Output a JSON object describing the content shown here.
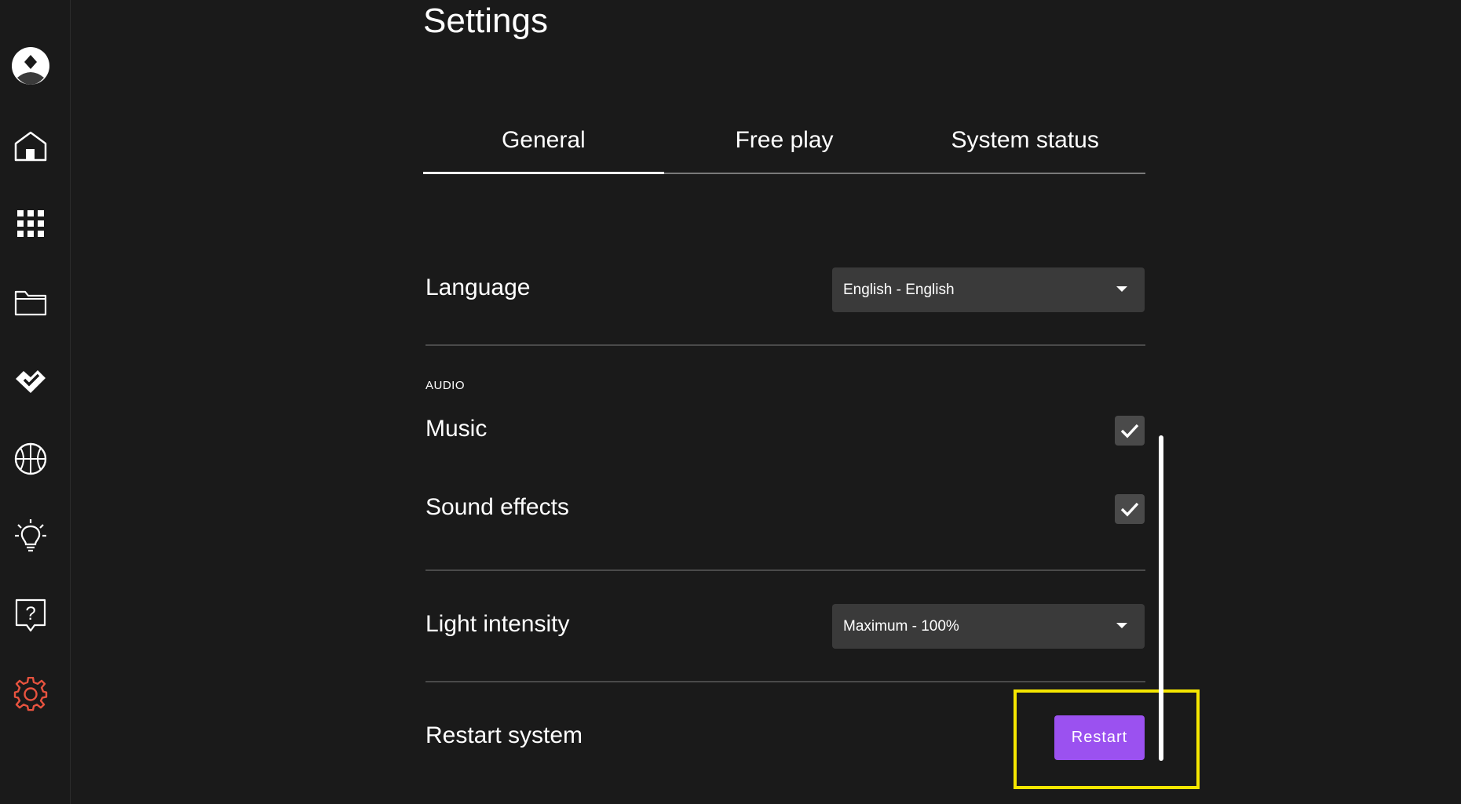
{
  "page": {
    "title": "Settings"
  },
  "sidebar": {
    "items": [
      {
        "icon": "avatar-icon"
      },
      {
        "icon": "home-icon"
      },
      {
        "icon": "grid-icon"
      },
      {
        "icon": "folder-icon"
      },
      {
        "icon": "heart-check-icon"
      },
      {
        "icon": "basketball-icon"
      },
      {
        "icon": "lightbulb-icon"
      },
      {
        "icon": "help-icon"
      },
      {
        "icon": "gear-icon",
        "active": true,
        "color": "#e8533f"
      }
    ]
  },
  "tabs": [
    {
      "label": "General",
      "active": true
    },
    {
      "label": "Free play",
      "active": false
    },
    {
      "label": "System status",
      "active": false
    }
  ],
  "settings": {
    "language": {
      "label": "Language",
      "value": "English - English"
    },
    "audio": {
      "section_label": "AUDIO",
      "music": {
        "label": "Music",
        "checked": true
      },
      "sound_effects": {
        "label": "Sound effects",
        "checked": true
      }
    },
    "light_intensity": {
      "label": "Light intensity",
      "value": "Maximum - 100%"
    },
    "restart": {
      "label": "Restart system",
      "button_label": "Restart"
    }
  },
  "colors": {
    "background": "#1a1a1a",
    "accent": "#9b51f0",
    "active_nav": "#e8533f",
    "highlight": "#f5e600"
  }
}
